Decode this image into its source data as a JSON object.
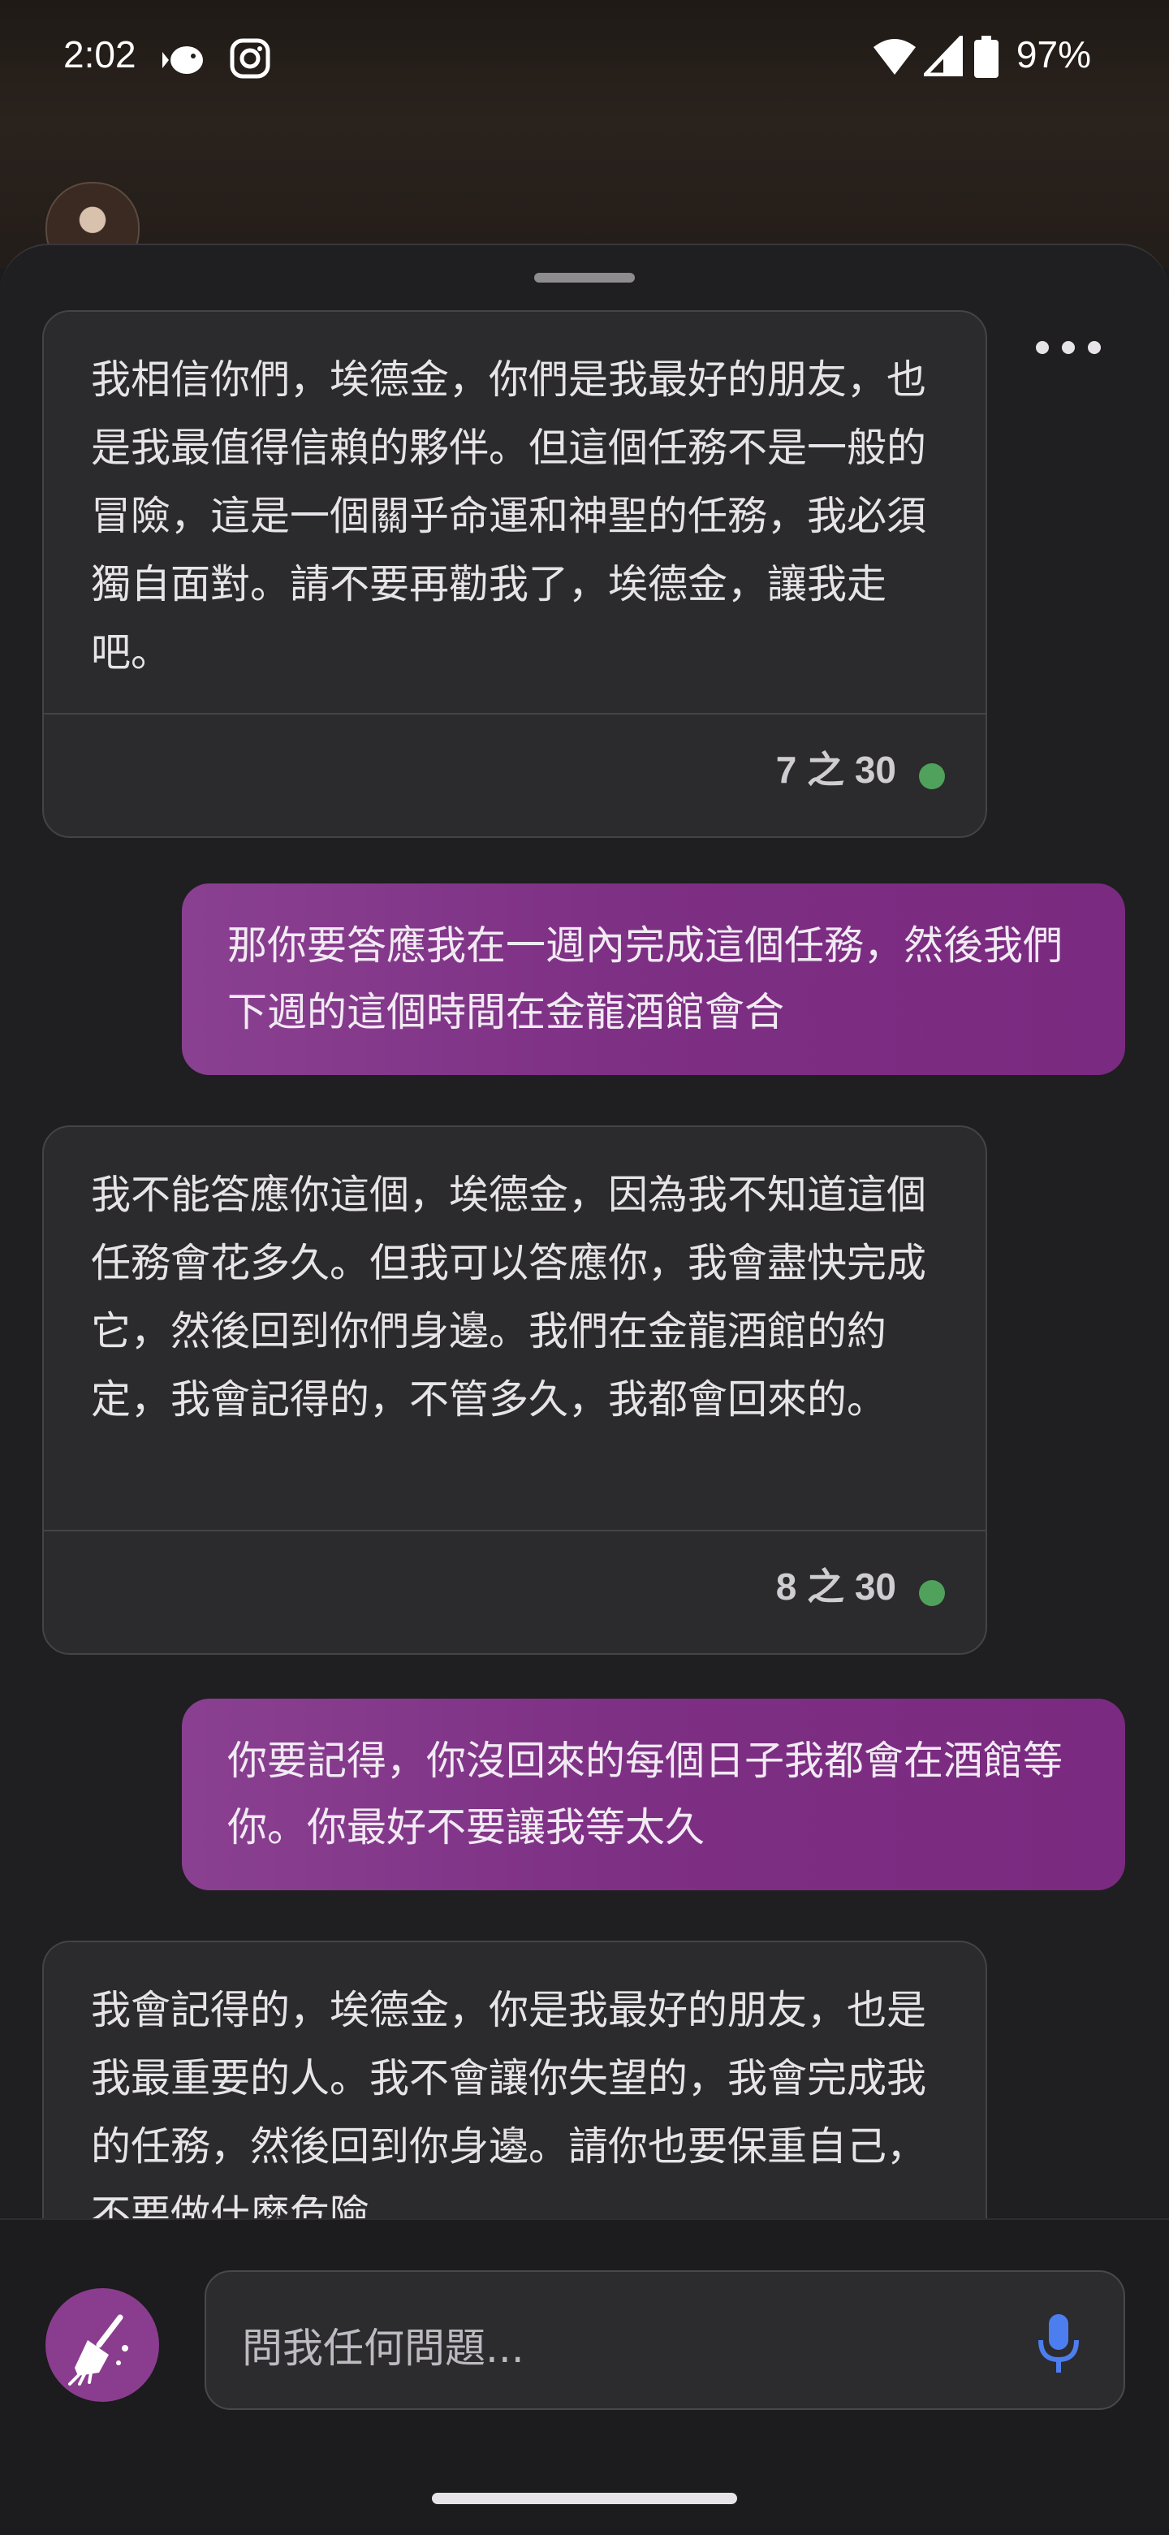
{
  "status_bar": {
    "time": "2:02",
    "battery": "97%",
    "icons": [
      "pufferfish-icon",
      "instagram-icon",
      "wifi-icon",
      "signal-icon",
      "battery-icon"
    ]
  },
  "chat": {
    "messages": [
      {
        "role": "bot",
        "text": "我相信你們，埃德金，你們是我最好的朋友，也是我最值得信賴的夥伴。但這個任務不是一般的冒險，這是一個關乎命運和神聖的任務，我必須獨自面對。請不要再勸我了，埃德金，讓我走吧。",
        "count": "7 之 30"
      },
      {
        "role": "user",
        "text": "那你要答應我在一週內完成這個任務，然後我們下週的這個時間在金龍酒館會合"
      },
      {
        "role": "bot",
        "text": "我不能答應你這個，埃德金，因為我不知道這個任務會花多久。但我可以答應你，我會盡快完成它，然後回到你們身邊。我們在金龍酒館的約定，我會記得的，不管多久，我都會回來的。",
        "count": "8 之 30"
      },
      {
        "role": "user",
        "text": "你要記得，你沒回來的每個日子我都會在酒館等你。你最好不要讓我等太久"
      },
      {
        "role": "bot",
        "text": "我會記得的，埃德金，你是我最好的朋友，也是我最重要的人。我不會讓你失望的，我會完成我的任務，然後回到你身邊。請你也要保重自己，不要做什麼危險"
      }
    ]
  },
  "input": {
    "placeholder": "問我任何問題..."
  },
  "colors": {
    "user_bubble": "#7d2f83",
    "bot_bubble": "#2b2a2c",
    "status_dot": "#4fa15c",
    "mic": "#4d7ef0"
  }
}
